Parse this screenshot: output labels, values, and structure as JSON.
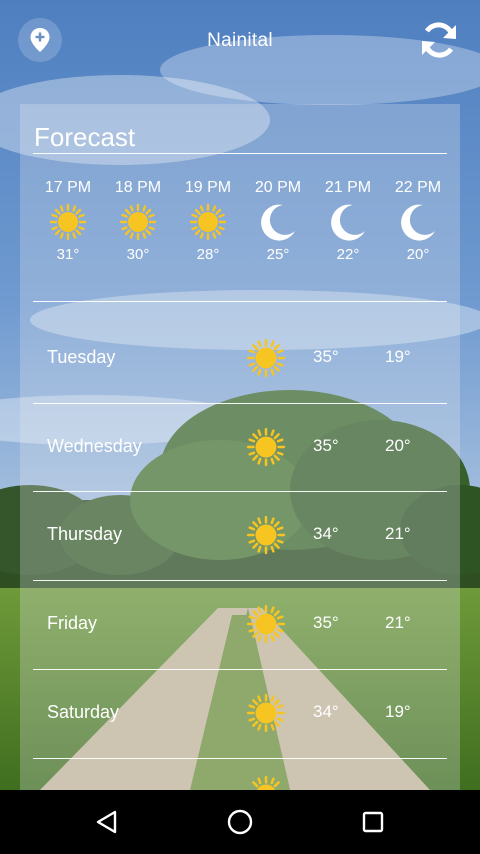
{
  "header": {
    "city": "Nainital",
    "location_icon": "location-pin-icon",
    "refresh_icon": "refresh-icon"
  },
  "forecast": {
    "title": "Forecast",
    "hourly": [
      {
        "time": "17 PM",
        "icon": "sun-icon",
        "temp": "31°"
      },
      {
        "time": "18 PM",
        "icon": "sun-icon",
        "temp": "30°"
      },
      {
        "time": "19 PM",
        "icon": "sun-icon",
        "temp": "28°"
      },
      {
        "time": "20 PM",
        "icon": "moon-icon",
        "temp": "25°"
      },
      {
        "time": "21 PM",
        "icon": "moon-icon",
        "temp": "22°"
      },
      {
        "time": "22 PM",
        "icon": "moon-icon",
        "temp": "20°"
      }
    ],
    "daily": [
      {
        "day": "Tuesday",
        "icon": "sun-icon",
        "high": "35°",
        "low": "19°"
      },
      {
        "day": "Wednesday",
        "icon": "sun-icon",
        "high": "35°",
        "low": "20°"
      },
      {
        "day": "Thursday",
        "icon": "sun-icon",
        "high": "34°",
        "low": "21°"
      },
      {
        "day": "Friday",
        "icon": "sun-icon",
        "high": "35°",
        "low": "21°"
      },
      {
        "day": "Saturday",
        "icon": "sun-icon",
        "high": "34°",
        "low": "19°"
      }
    ]
  },
  "navbar": {
    "back_icon": "back-icon",
    "home_icon": "home-icon",
    "recents_icon": "recents-icon"
  },
  "colors": {
    "sun": "#f7c521",
    "moon": "#ffffff",
    "navbar": "#000000"
  }
}
